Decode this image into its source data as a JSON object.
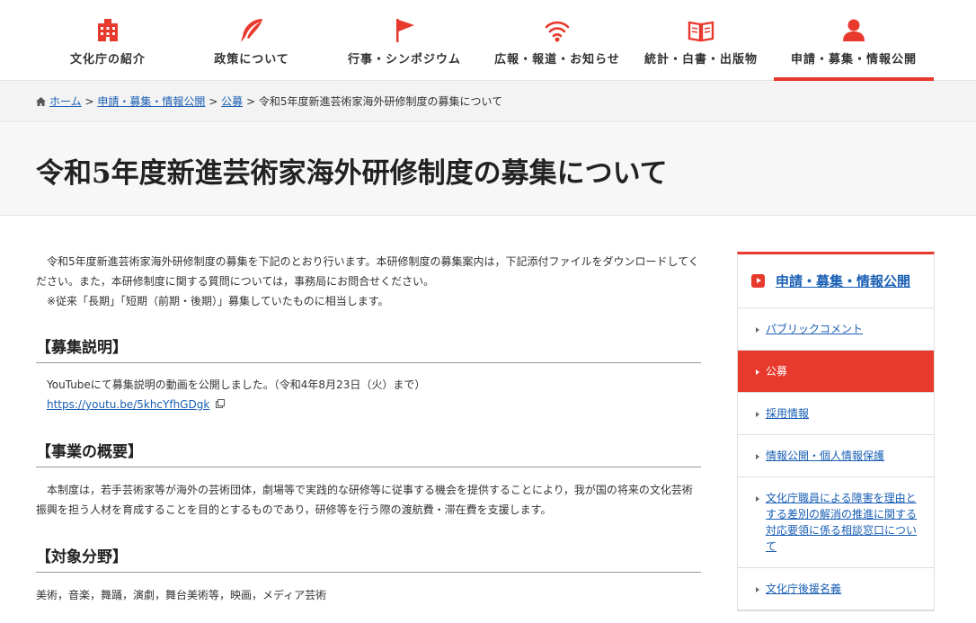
{
  "nav": {
    "items": [
      {
        "label": "文化庁の紹介",
        "icon": "building-icon"
      },
      {
        "label": "政策について",
        "icon": "quill-pen-icon"
      },
      {
        "label": "行事・シンポジウム",
        "icon": "flag-icon"
      },
      {
        "label": "広報・報道・お知らせ",
        "icon": "broadcast-icon"
      },
      {
        "label": "統計・白書・出版物",
        "icon": "book-icon"
      },
      {
        "label": "申請・募集・情報公開",
        "icon": "person-icon"
      }
    ],
    "active_index": 5
  },
  "breadcrumb": {
    "home": "ホーム",
    "level1": "申請・募集・情報公開",
    "level2": "公募",
    "current": "令和5年度新進芸術家海外研修制度の募集について",
    "sep": ">"
  },
  "page_title": "令和5年度新進芸術家海外研修制度の募集について",
  "intro": "令和5年度新進芸術家海外研修制度の募集を下記のとおり行います。本研修制度の募集案内は，下記添付ファイルをダウンロードしてください。また，本研修制度に関する質問については，事務局にお問合せください。",
  "note": "※従来「長期」「短期（前期・後期）」募集していたものに相当します。",
  "sections": {
    "explain": {
      "heading": "【募集説明】",
      "text": "YouTubeにて募集説明の動画を公開しました。（令和4年8月23日（火）まで）",
      "link": "https://youtu.be/5khcYfhGDgk"
    },
    "overview": {
      "heading": "【事業の概要】",
      "text": "本制度は，若手芸術家等が海外の芸術団体，劇場等で実践的な研修等に従事する機会を提供することにより，我が国の将来の文化芸術振興を担う人材を育成することを目的とするものであり，研修等を行う際の渡航費・滞在費を支援します。"
    },
    "fields": {
      "heading": "【対象分野】",
      "text": "美術，音楽，舞踊，演劇，舞台美術等，映画，メディア芸術"
    }
  },
  "sidebar": {
    "heading": "申請・募集・情報公開",
    "items": [
      {
        "label": "パブリックコメント"
      },
      {
        "label": "公募"
      },
      {
        "label": "採用情報"
      },
      {
        "label": "情報公開・個人情報保護"
      },
      {
        "label": "文化庁職員による障害を理由とする差別の解消の推進に関する対応要領に係る相談窓口について"
      },
      {
        "label": "文化庁後援名義"
      }
    ],
    "active_index": 1
  },
  "colors": {
    "accent": "#e8392d",
    "link": "#1a5fb4"
  }
}
